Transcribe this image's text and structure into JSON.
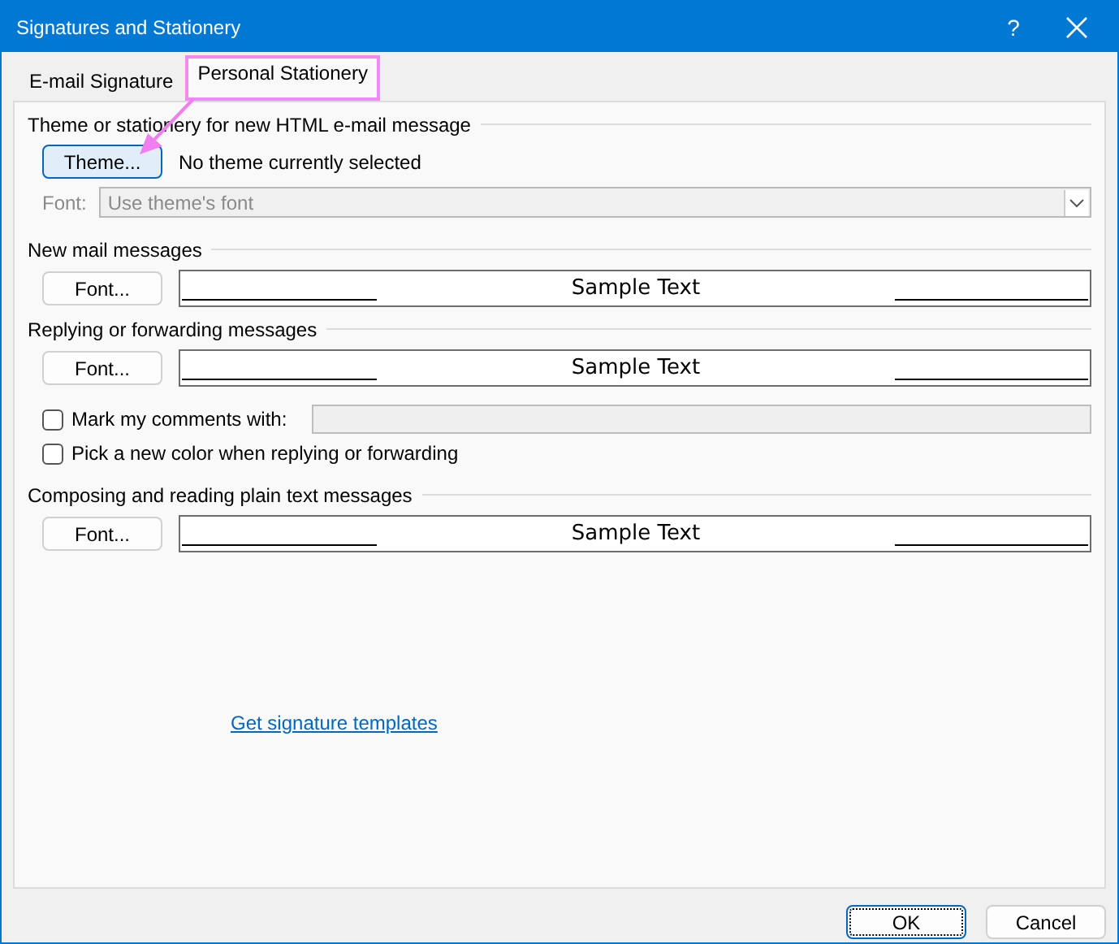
{
  "window": {
    "title": "Signatures and Stationery",
    "help_button": "?"
  },
  "tabs": [
    {
      "label": "E-mail Signature",
      "selected": false,
      "annotated": false
    },
    {
      "label": "Personal Stationery",
      "selected": true,
      "annotated": true
    }
  ],
  "theme_section": {
    "heading": "Theme or stationery for new HTML e-mail message",
    "button": "Theme...",
    "button_focused": true,
    "status": "No theme currently selected",
    "font_label": "Font:",
    "font_value": "Use theme's font",
    "font_disabled": true
  },
  "sections": [
    {
      "heading": "New mail messages",
      "button": "Font...",
      "sample": "Sample Text"
    },
    {
      "heading": "Replying or forwarding messages",
      "button": "Font...",
      "sample": "Sample Text",
      "options": [
        {
          "kind": "field",
          "label": "Mark my comments with:",
          "checked": false,
          "disabled": true
        },
        {
          "kind": "checkbox",
          "label": "Pick a new color when replying or forwarding",
          "checked": false
        }
      ]
    },
    {
      "heading": "Composing and reading plain text messages",
      "button": "Font...",
      "sample": "Sample Text"
    }
  ],
  "link": "Get signature templates",
  "buttons": [
    {
      "label": "OK",
      "default": true
    },
    {
      "label": "Cancel",
      "default": false
    }
  ]
}
